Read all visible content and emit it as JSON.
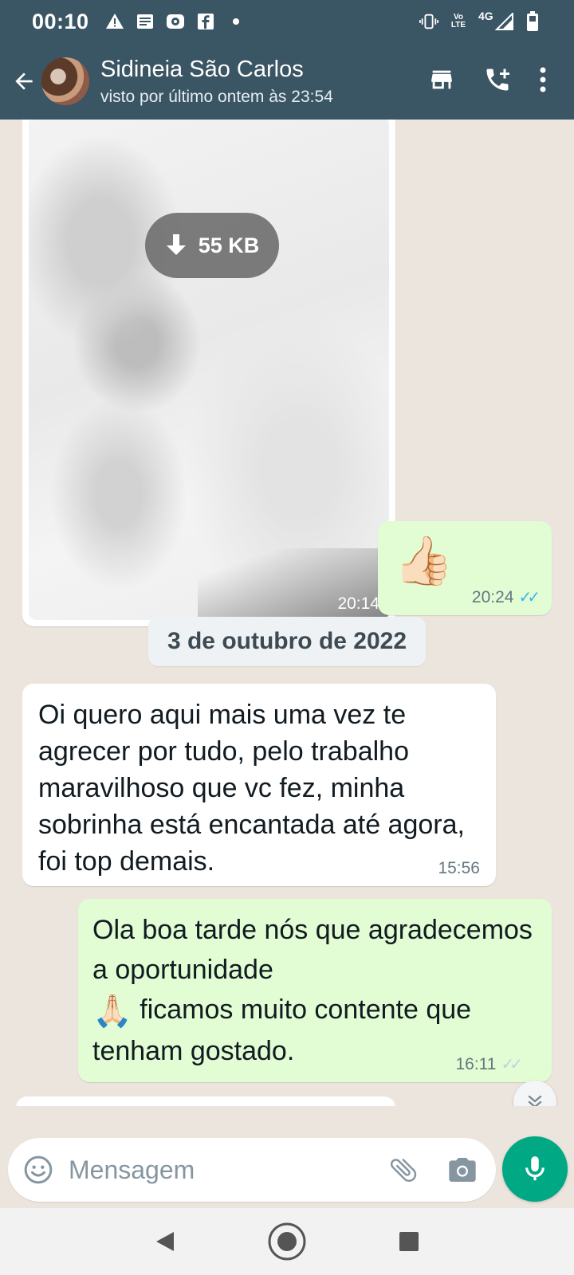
{
  "status_bar": {
    "time": "00:10",
    "network": "4G",
    "volte": "Vo LTE"
  },
  "header": {
    "contact_name": "Sidineia São Carlos",
    "last_seen": "visto por último ontem às 23:54"
  },
  "messages": {
    "image": {
      "size_label": "55 KB",
      "time": "20:14"
    },
    "thumbs": {
      "emoji": "👍🏻",
      "time": "20:24"
    },
    "date_chip": "3 de outubro de 2022",
    "incoming_text": {
      "text": "Oi quero aqui mais uma vez te agrecer por tudo, pelo trabalho maravilhoso que vc fez, minha sobrinha está encantada até agora, foi top demais.",
      "time": "15:56"
    },
    "outgoing_text": {
      "text_part1": "Ola boa tarde nós que agradecemos a oportunidade",
      "emoji": "🙏🏻",
      "text_part2": " ficamos muito contente que tenham gostado.",
      "time": "16:11"
    }
  },
  "input": {
    "placeholder": "Mensagem"
  },
  "colors": {
    "header_bg": "#3a5563",
    "outgoing_bubble": "#e2fcd3",
    "incoming_bubble": "#ffffff",
    "accent_green": "#00a884",
    "read_ticks": "#34b7f1"
  },
  "icons": {
    "status": [
      "alert-icon",
      "news-icon",
      "record-icon",
      "facebook-icon",
      "dot-icon",
      "vibrate-icon",
      "signal-icon",
      "battery-icon"
    ],
    "header": [
      "back-arrow-icon",
      "store-icon",
      "add-call-icon",
      "more-vert-icon"
    ],
    "input": [
      "emoji-icon",
      "attach-icon",
      "camera-icon",
      "mic-icon"
    ],
    "nav": [
      "nav-back-icon",
      "nav-home-icon",
      "nav-recents-icon"
    ]
  }
}
